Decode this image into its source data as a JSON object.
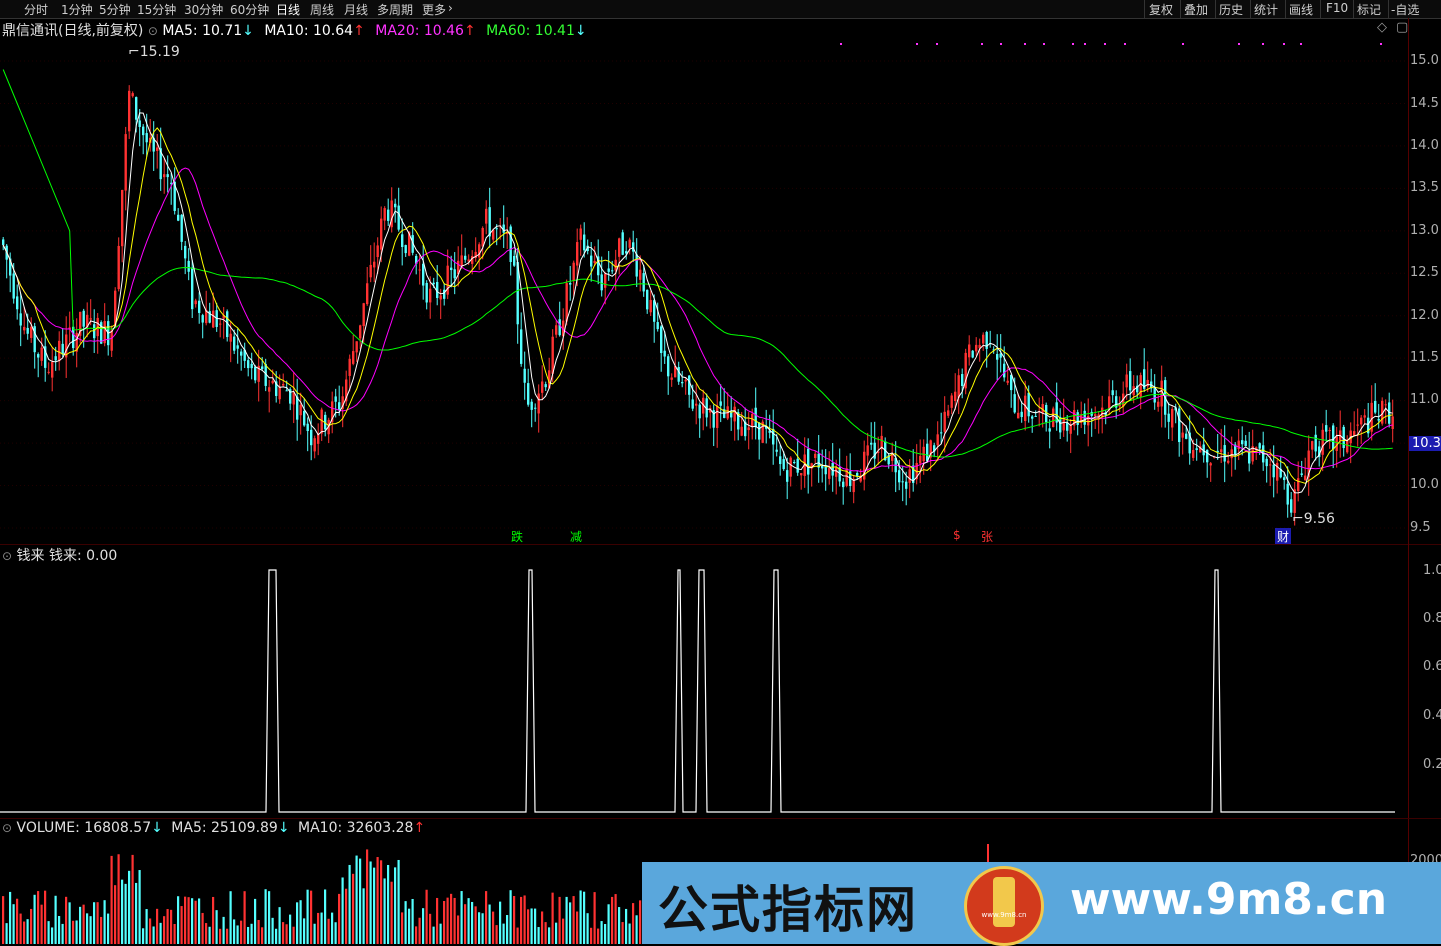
{
  "toolbar": {
    "timeframes": [
      "分时",
      "1分钟",
      "5分钟",
      "15分钟",
      "30分钟",
      "60分钟",
      "日线",
      "周线",
      "月线",
      "多周期",
      "更多"
    ],
    "right_buttons": [
      "复权",
      "叠加",
      "历史",
      "统计",
      "画线",
      "F10",
      "标记",
      "-自选"
    ]
  },
  "main": {
    "title": "鼎信通讯(日线,前复权)",
    "ma5": "MA5: 10.71",
    "ma5_dir": "↓",
    "ma10": "MA10: 10.64",
    "ma10_dir": "↑",
    "ma20": "MA20: 10.46",
    "ma20_dir": "↑",
    "ma60": "MA60: 10.41",
    "ma60_dir": "↓",
    "high_label": "15.19",
    "low_label": "9.56",
    "current_price": "10.3",
    "price_ticks": [
      "15.0",
      "14.5",
      "14.0",
      "13.5",
      "13.0",
      "12.5",
      "12.0",
      "11.5",
      "11.0",
      "10.5",
      "10.0",
      "9.5"
    ],
    "signals": [
      "跌",
      "减",
      "$",
      "张",
      "财"
    ]
  },
  "indicator": {
    "name": "钱来",
    "value_label": "钱来: 0.00",
    "ticks": [
      "1.0",
      "0.8",
      "0.6",
      "0.4",
      "0.2"
    ]
  },
  "volume": {
    "volume_label": "VOLUME: 16808.57",
    "volume_dir": "↓",
    "ma5": "MA5: 25109.89",
    "ma5_dir": "↓",
    "ma10": "MA10: 32603.28",
    "ma10_dir": "↑",
    "tick": "2000"
  },
  "watermark": {
    "title": "公式指标网",
    "url": "www.9m8.cn",
    "logo_text": "www.9m8.cn"
  },
  "colors": {
    "up": "#ff3232",
    "down": "#54ffff",
    "ma5": "#ffffff",
    "ma10": "#ffff00",
    "ma20": "#ff00ff",
    "ma60": "#00ff00"
  }
}
